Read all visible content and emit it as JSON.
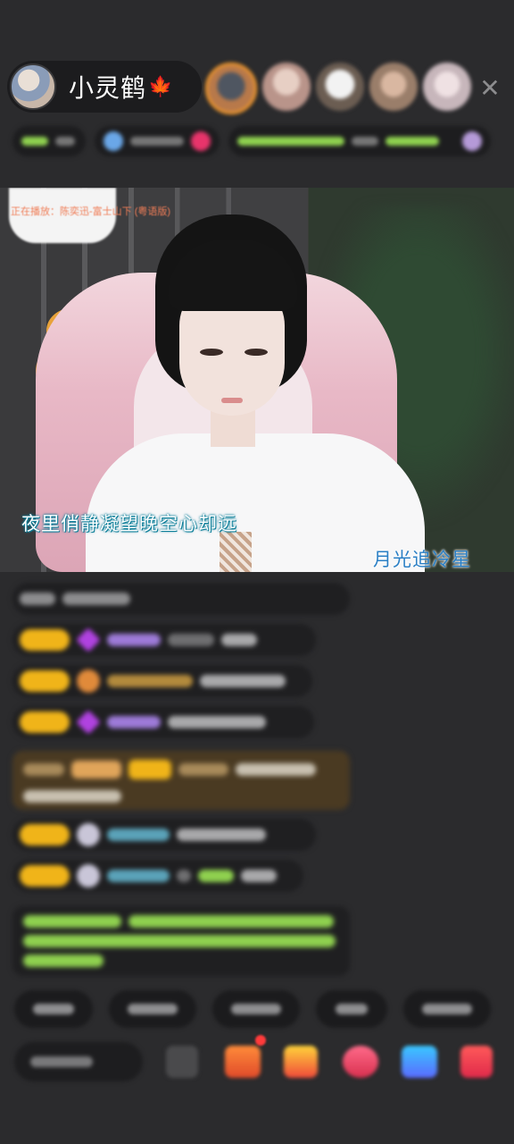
{
  "header": {
    "host_name": "小灵鹤",
    "host_name_emoji": "🍁",
    "close_glyph": "✕",
    "viewer_avatars": [
      {
        "name": "viewer-1",
        "color": "#b8794a",
        "highlight": true
      },
      {
        "name": "viewer-2",
        "color": "#b9948a"
      },
      {
        "name": "viewer-3",
        "color": "#d9d6d3"
      },
      {
        "name": "viewer-4",
        "color": "#9a7e6a"
      },
      {
        "name": "viewer-5",
        "color": "#c7b6bb"
      }
    ]
  },
  "video": {
    "song_info": "正在播放：陈奕迅-富士山下 (粤语版)",
    "lyric_line_1": "夜里俏静凝望晚空心却远",
    "lyric_line_2": "月光追冷星"
  },
  "colors": {
    "background": "#2b2b2d",
    "badge": "#f0b419",
    "accent_green": "#8fd14f",
    "accent_orange": "#f59a2b"
  }
}
